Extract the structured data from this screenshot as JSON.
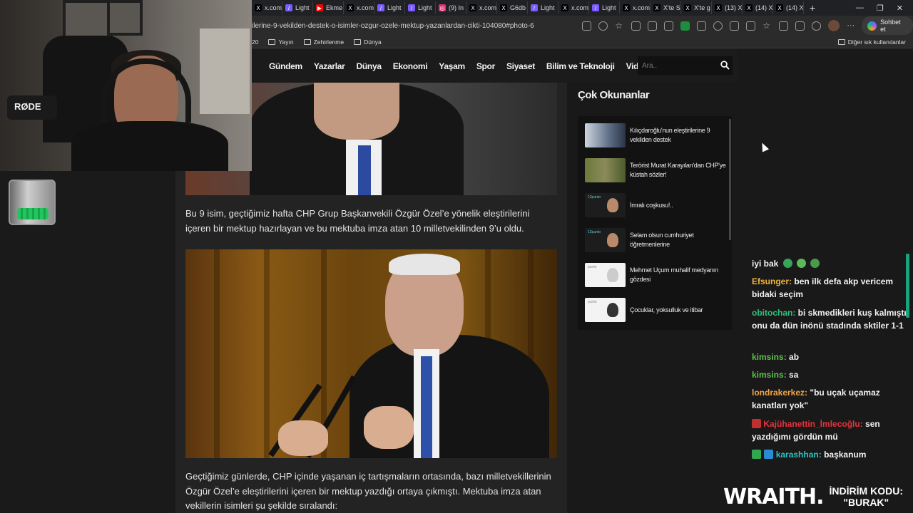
{
  "browser": {
    "tabs": [
      {
        "label": "x.com",
        "icon": "x-icon",
        "color": "#000000"
      },
      {
        "label": "Light",
        "icon": "feather-icon",
        "color": "#7b5cff"
      },
      {
        "label": "Ekme",
        "icon": "youtube-icon",
        "color": "#ff0000"
      },
      {
        "label": "x.com",
        "icon": "x-icon",
        "color": "#000000"
      },
      {
        "label": "Light",
        "icon": "feather-icon",
        "color": "#7b5cff"
      },
      {
        "label": "Light",
        "icon": "feather-icon",
        "color": "#7b5cff"
      },
      {
        "label": "(9) In",
        "icon": "instagram-icon",
        "color": "#e1306c"
      },
      {
        "label": "x.com",
        "icon": "x-icon",
        "color": "#000000"
      },
      {
        "label": "G6db",
        "icon": "x-icon",
        "color": "#000000"
      },
      {
        "label": "Light",
        "icon": "feather-icon",
        "color": "#7b5cff"
      },
      {
        "label": "x.com",
        "icon": "x-icon",
        "color": "#000000"
      },
      {
        "label": "Light",
        "icon": "feather-icon",
        "color": "#7b5cff"
      },
      {
        "label": "x.com",
        "icon": "x-icon",
        "color": "#000000"
      },
      {
        "label": "X'te S",
        "icon": "x-icon",
        "color": "#000000"
      },
      {
        "label": "X'te g",
        "icon": "x-icon",
        "color": "#000000"
      },
      {
        "label": "(13) X",
        "icon": "x-icon",
        "color": "#000000"
      },
      {
        "label": "(14) X",
        "icon": "x-icon",
        "color": "#000000"
      },
      {
        "label": "(14) X",
        "icon": "x-icon",
        "color": "#000000"
      }
    ],
    "url": "ilerine-9-vekilden-destek-o-isimler-ozgur-ozele-mektup-yazanlardan-cikti-104080#photo-6",
    "copilot_label": "Sohbet et",
    "bookmarks": [
      "20",
      "Yayın",
      "Zehirlenme",
      "Dünya"
    ],
    "other_bookmarks": "Diğer sık kullanılanlar"
  },
  "nav": {
    "items": [
      "Gündem",
      "Yazarlar",
      "Dünya",
      "Ekonomi",
      "Yaşam",
      "Spor",
      "Siyaset",
      "Bilim ve Teknoloji",
      "Video"
    ],
    "search_placeholder": "Ara.."
  },
  "article": {
    "paragraph1": "Bu 9 isim, geçtiğimiz hafta CHP Grup Başkanvekili Özgür Özel’e yönelik eleştirilerini içeren bir mektup hazırlayan ve bu mektuba imza atan 10 milletvekilinden 9’u oldu.",
    "paragraph2": "Geçtiğimiz günlerde, CHP içinde yaşanan iç tartışmaların ortasında, bazı milletvekillerinin Özgür Özel’e eleştirilerini içeren bir mektup yazdığı ortaya çıkmıştı. Mektuba imza atan vekillerin isimleri şu şekilde sıralandı:"
  },
  "sidebar": {
    "title": "Çok Okunanlar",
    "items": [
      {
        "text": "Kılıçdaroğlu'nun eleştirilerine 9 vekilden destek"
      },
      {
        "text": "Terörist Murat Karayılan'dan CHP'ye küstah sözler!"
      },
      {
        "text": "İmralı coşkusu!..",
        "thumb_label": "12punto"
      },
      {
        "text": "Selam olsun cumhuriyet öğretmenlerine",
        "thumb_label": "12punto"
      },
      {
        "text": "Mehmet Uçum muhalif medyanın gözdesi",
        "thumb_label": "punto"
      },
      {
        "text": "Çocuklar, yoksulluk ve itibar",
        "thumb_label": "punto"
      }
    ]
  },
  "stream": {
    "mic_brand": "RØDE",
    "chat": [
      {
        "user": "",
        "user_color": "#ffffff",
        "text": "iyi bak"
      },
      {
        "user": "Efsunger:",
        "user_color": "#f0b43c",
        "text": "ben ilk defa akp vericem bidaki seçim"
      },
      {
        "user": "obitochan:",
        "user_color": "#2ec27e",
        "text": "bi skmedikleri kuş kalmıştı onu da dün inönü stadında sktiler 1-1"
      },
      {
        "user": "kimsins:",
        "user_color": "#5ec24a",
        "text": "ab"
      },
      {
        "user": "kimsins:",
        "user_color": "#5ec24a",
        "text": "sa"
      },
      {
        "user": "londrakerkez:",
        "user_color": "#f0a64a",
        "text": "\"bu uçak uçamaz kanatları yok\""
      },
      {
        "user": "Kajühanettin_İmlecoğlu:",
        "user_color": "#e8323c",
        "text": "sen yazdığımı gördün mü"
      },
      {
        "user": "karashhan:",
        "user_color": "#2ec2c2",
        "text": "başkanum"
      }
    ],
    "promo_brand": "WRAITH.",
    "promo_line1": "İNDİRİM KODU:",
    "promo_line2": "\"BURAK\""
  },
  "colors": {
    "page_bg": "#191919",
    "article_bg": "#232323",
    "sidebar_box": "#121212",
    "chat_scroll": "#1aa37a"
  }
}
